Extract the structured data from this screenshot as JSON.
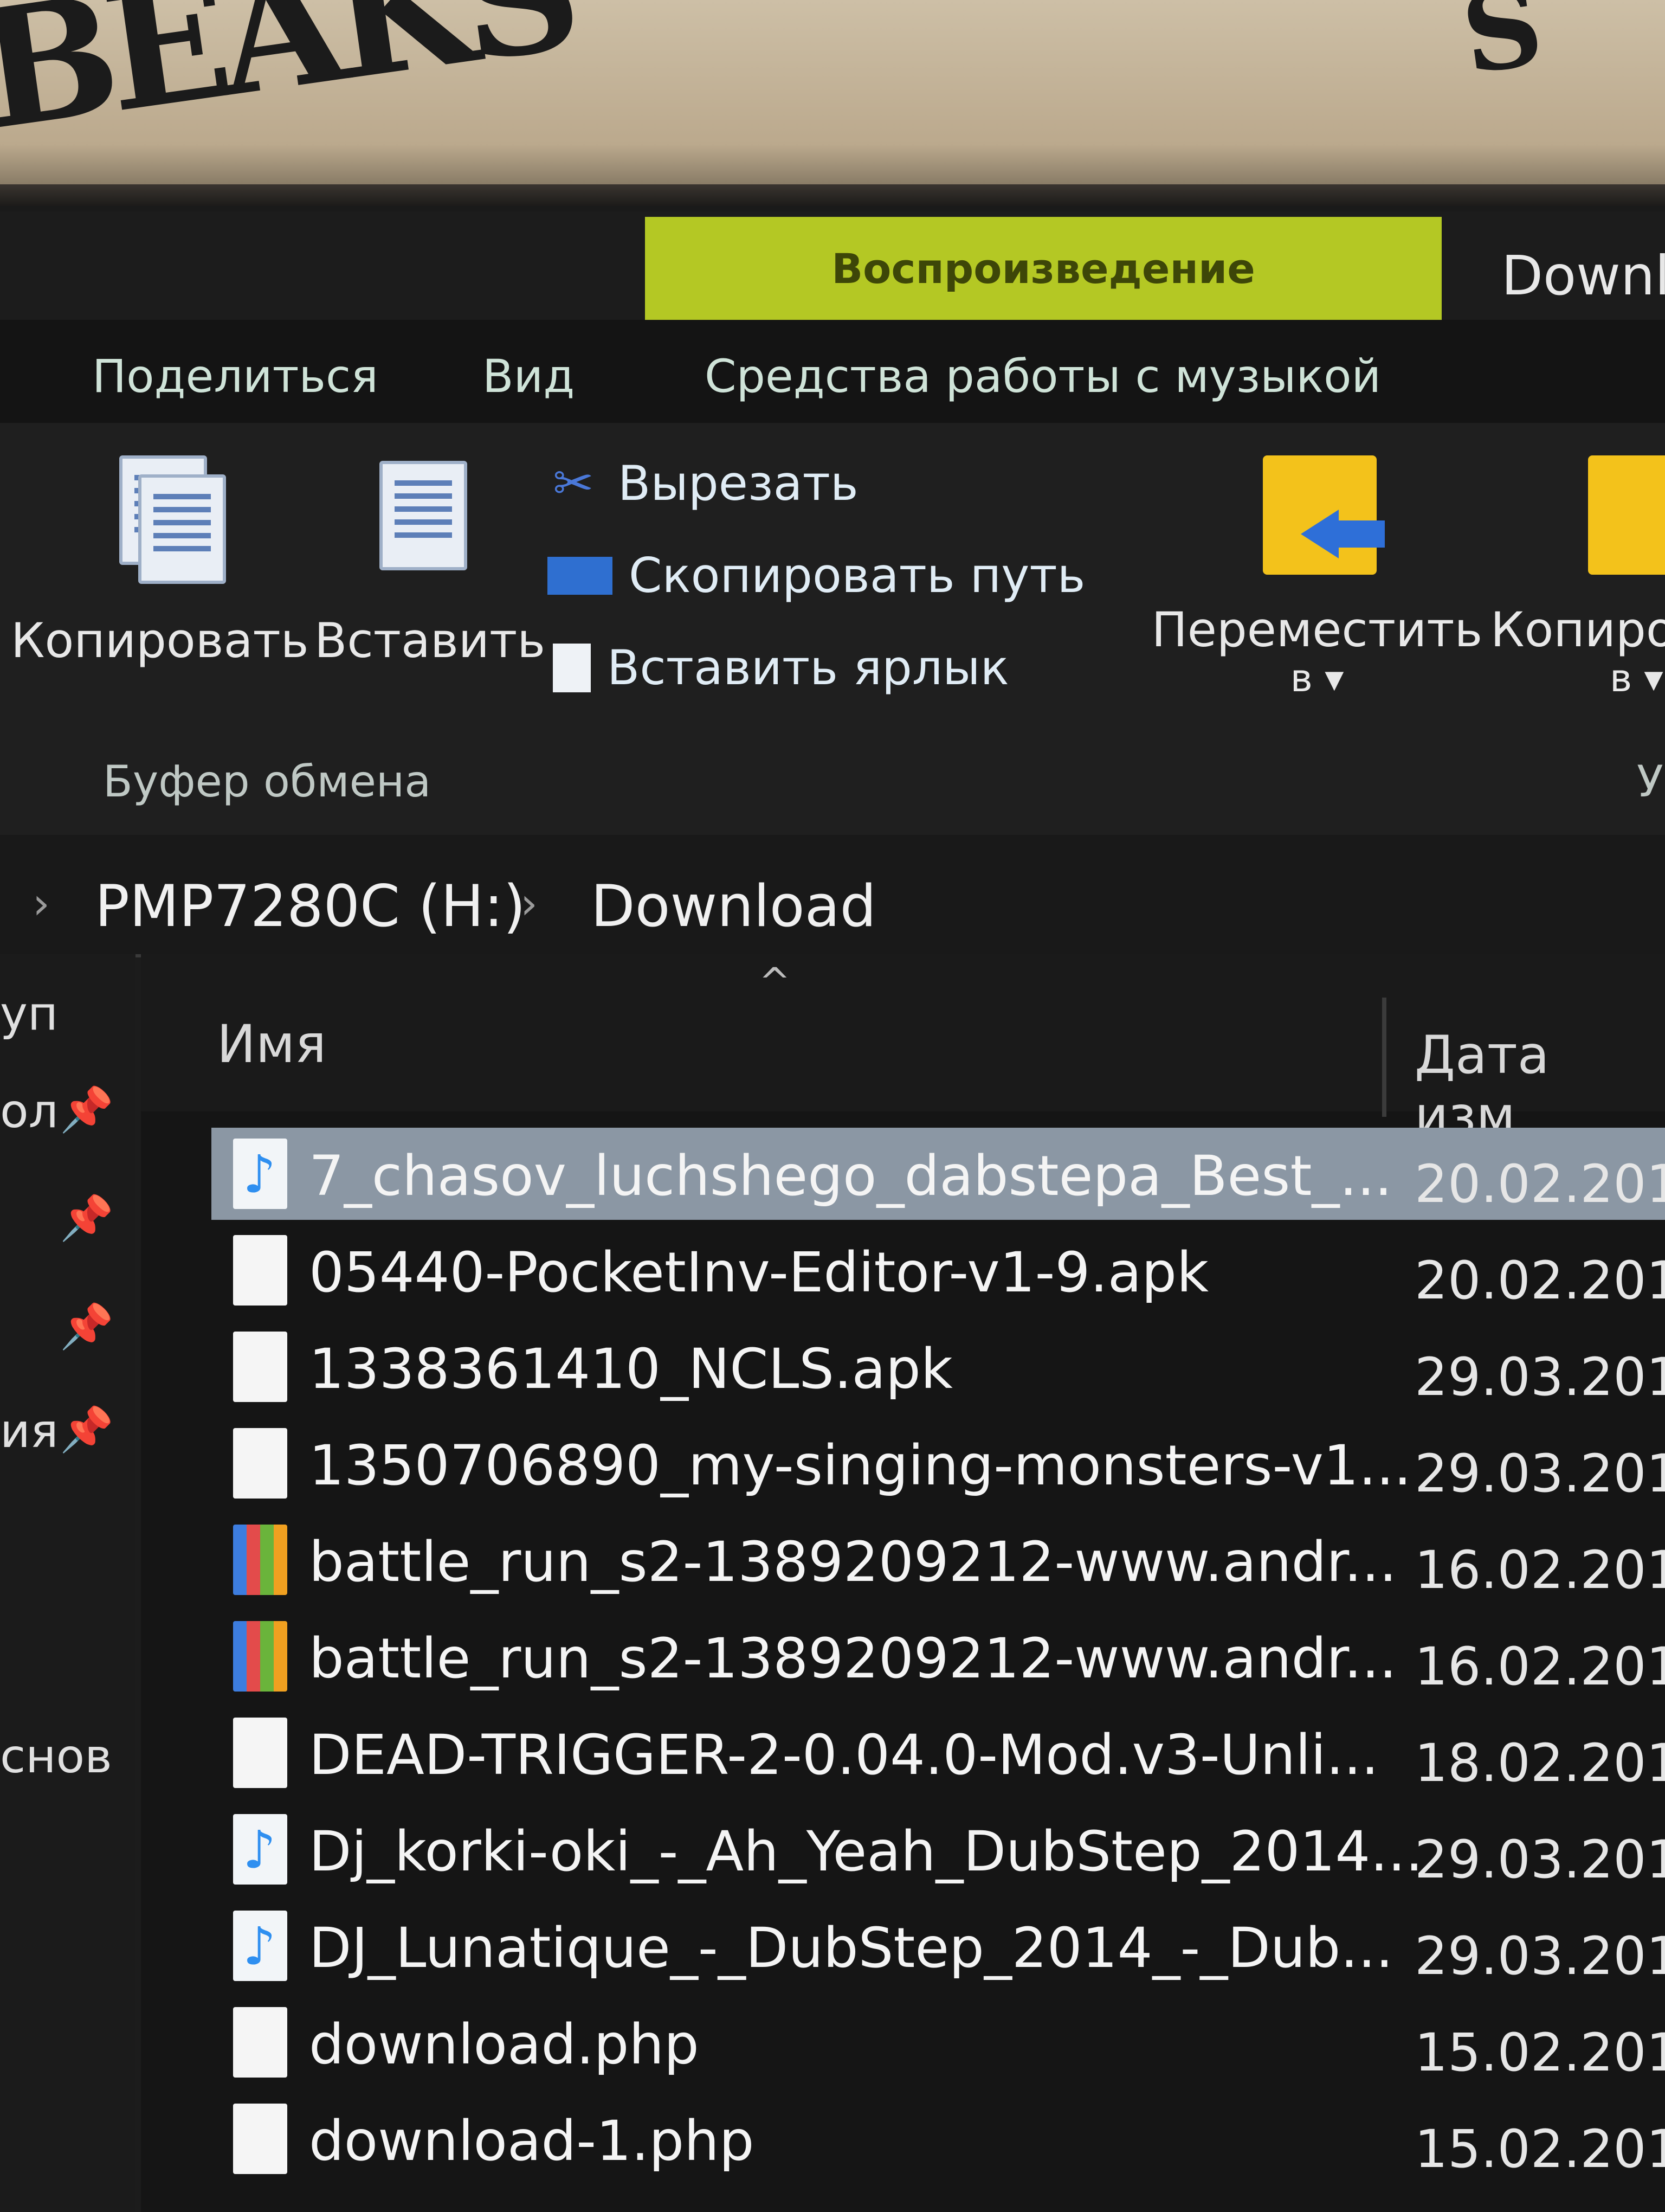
{
  "ribbon_tabs": {
    "context_tab": "Воспроизведение",
    "window_title_partial": "Downl",
    "menu": [
      "Поделиться",
      "Вид",
      "Средства работы с музыкой"
    ]
  },
  "ribbon": {
    "copy_label": "Копировать",
    "paste_label": "Вставить",
    "cut_label": "Вырезать",
    "copy_path_label": "Скопировать путь",
    "paste_shortcut_label": "Вставить ярлык",
    "move_to_label": "Переместить",
    "move_to_sub": "в",
    "copy_to_label": "Копиро",
    "copy_to_sub": "в",
    "clipboard_group": "Буфер обмена",
    "group_right_partial": "У"
  },
  "address": {
    "crumbs": [
      "PMP7280C (H:)",
      "Download"
    ]
  },
  "nav": [
    "уп",
    "ол",
    "ия",
    "снов"
  ],
  "columns": {
    "name": "Имя",
    "date": "Дата изм"
  },
  "files": [
    {
      "name": "7_chasov_luchshego_dabstepa_Best_...",
      "date": "20.02.201",
      "icon": "audio-file-icon",
      "selected": true
    },
    {
      "name": "05440-PocketInv-Editor-v1-9.apk",
      "date": "20.02.201",
      "icon": "blank-file-icon"
    },
    {
      "name": "1338361410_NCLS.apk",
      "date": "29.03.201",
      "icon": "blank-file-icon"
    },
    {
      "name": "1350706890_my-singing-monsters-v1...",
      "date": "29.03.201",
      "icon": "blank-file-icon"
    },
    {
      "name": "battle_run_s2-1389209212-www.andr...",
      "date": "16.02.201",
      "icon": "rar-archive-icon"
    },
    {
      "name": "battle_run_s2-1389209212-www.andr...",
      "date": "16.02.201",
      "icon": "rar-archive-icon"
    },
    {
      "name": "DEAD-TRIGGER-2-0.04.0-Mod.v3-Unli...",
      "date": "18.02.201",
      "icon": "blank-file-icon"
    },
    {
      "name": "Dj_korki-oki_-_Ah_Yeah_DubStep_2014...",
      "date": "29.03.201",
      "icon": "audio-file-icon"
    },
    {
      "name": "DJ_Lunatique_-_DubStep_2014_-_Dub...",
      "date": "29.03.201",
      "icon": "audio-file-icon"
    },
    {
      "name": "download.php",
      "date": "15.02.201",
      "icon": "blank-file-icon"
    },
    {
      "name": "download-1.php",
      "date": "15.02.201",
      "icon": "blank-file-icon"
    }
  ]
}
